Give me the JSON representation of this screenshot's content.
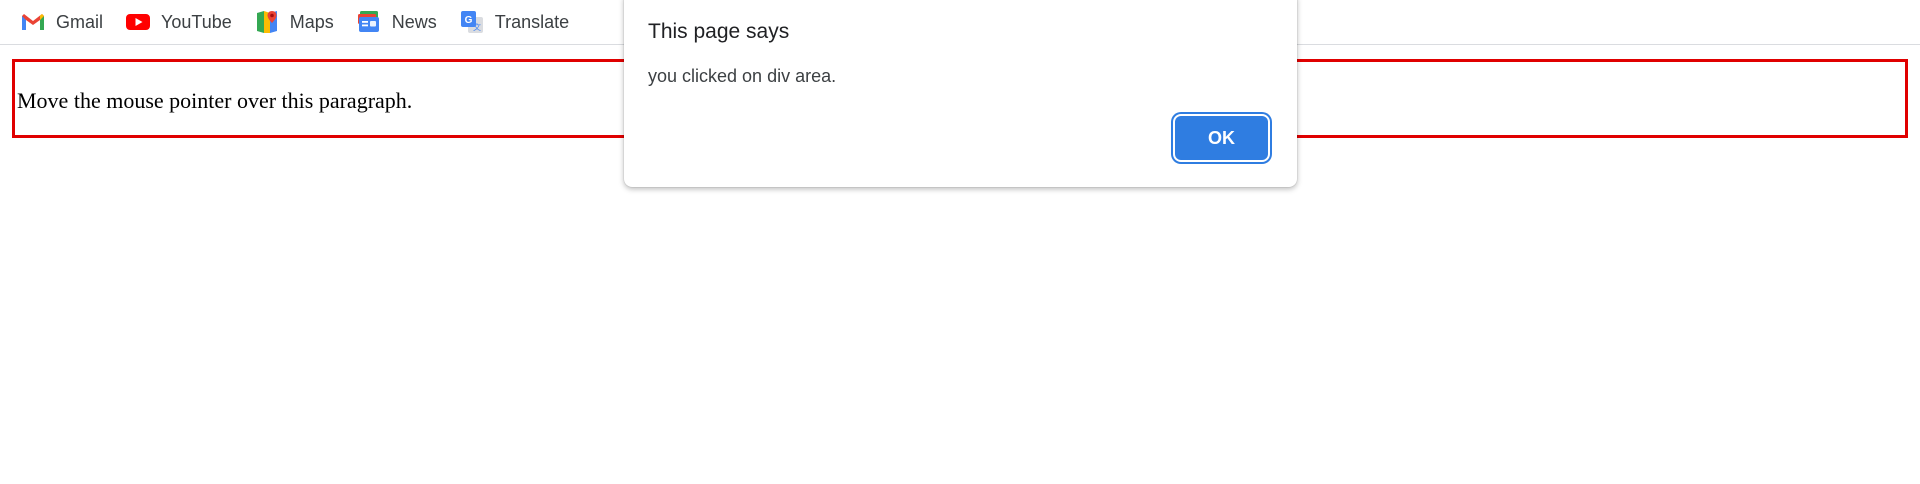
{
  "bookmarks": [
    {
      "label": "Gmail",
      "icon": "gmail-icon"
    },
    {
      "label": "YouTube",
      "icon": "youtube-icon"
    },
    {
      "label": "Maps",
      "icon": "maps-icon"
    },
    {
      "label": "News",
      "icon": "news-icon"
    },
    {
      "label": "Translate",
      "icon": "translate-icon"
    }
  ],
  "page": {
    "paragraph": "Move the mouse pointer over this paragraph.",
    "border_color": "#e00000"
  },
  "dialog": {
    "title": "This page says",
    "message": "you clicked on div area.",
    "ok_label": "OK",
    "button_color": "#2f7de1"
  }
}
